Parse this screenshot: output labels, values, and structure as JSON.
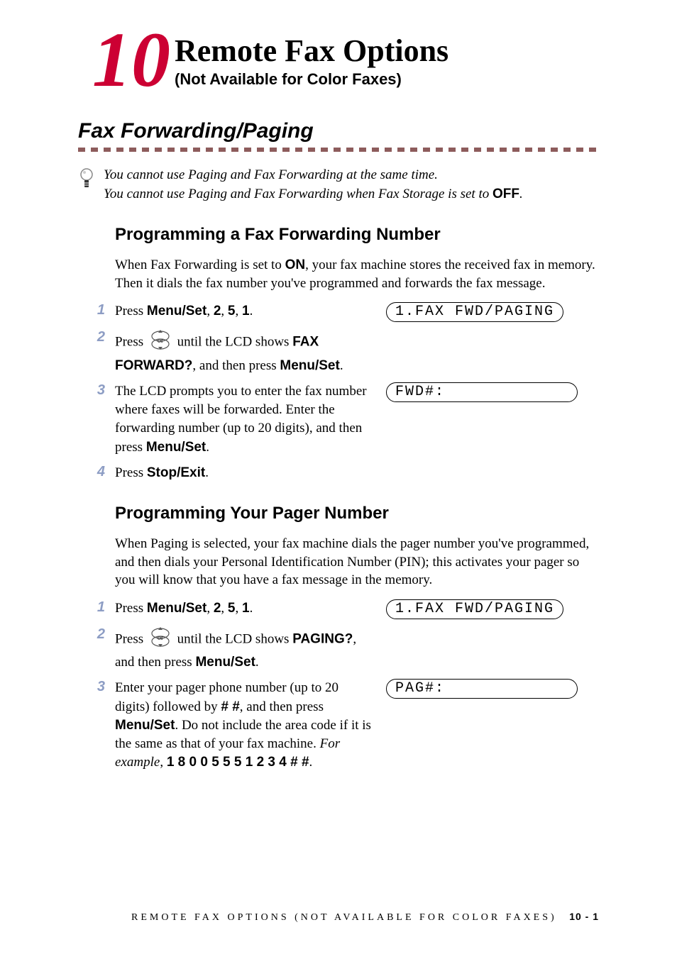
{
  "chapter": {
    "number": "10",
    "title": "Remote Fax Options",
    "subtitle": "(Not Available for Color Faxes)"
  },
  "section": {
    "title": "Fax Forwarding/Paging",
    "note_line1": "You cannot use Paging and Fax Forwarding at the same time.",
    "note_line2_a": "You cannot use Paging and Fax Forwarding when Fax Storage is set to ",
    "note_line2_b": "OFF",
    "note_line2_c": "."
  },
  "sub1": {
    "heading": "Programming a Fax Forwarding Number",
    "intro_a": "When Fax Forwarding is set to ",
    "intro_on": "ON",
    "intro_b": ", your fax machine stores the received fax in memory. Then it dials the fax number you've programmed and forwards the fax message.",
    "step1_a": "Press ",
    "step1_b": "Menu/Set",
    "step1_c": ", ",
    "step1_d": "2",
    "step1_e": ", ",
    "step1_f": "5",
    "step1_g": ", ",
    "step1_h": "1",
    "step1_i": ".",
    "lcd1": "1.FAX FWD/PAGING",
    "step2_a": "Press ",
    "step2_b": " until the LCD shows ",
    "step2_c": "FAX FORWARD?",
    "step2_d": ", and then press ",
    "step2_e": "Menu/Set",
    "step2_f": ".",
    "step3_a": "The LCD prompts you to enter the fax number where faxes will be forwarded. Enter the forwarding number (up to 20 digits), and then press ",
    "step3_b": "Menu/Set",
    "step3_c": ".",
    "lcd3": "FWD#:",
    "step4_a": "Press ",
    "step4_b": "Stop/Exit",
    "step4_c": "."
  },
  "sub2": {
    "heading": "Programming Your Pager Number",
    "intro": "When Paging is selected, your fax machine dials the pager number you've programmed, and then dials your Personal Identification Number (PIN); this activates your pager so you will know that you have a fax message in the memory.",
    "step1_a": "Press ",
    "step1_b": "Menu/Set",
    "step1_c": ", ",
    "step1_d": "2",
    "step1_e": ", ",
    "step1_f": "5",
    "step1_g": ", ",
    "step1_h": "1",
    "step1_i": ".",
    "lcd1": "1.FAX FWD/PAGING",
    "step2_a": "Press ",
    "step2_b": " until the LCD shows ",
    "step2_c": "PAGING?",
    "step2_d": ", and then press ",
    "step2_e": "Menu/Set",
    "step2_f": ".",
    "step3_a": "Enter your pager phone number (up to 20 digits) followed by ",
    "step3_b": "# #",
    "step3_c": ", and then press ",
    "step3_d": "Menu/Set",
    "step3_e": ". Do not include the area code if it is the same as that of your fax machine. ",
    "step3_eg_a": "For example",
    "step3_eg_b": ", ",
    "step3_eg_c": "1 8 0 0 5 5 5 1 2 3 4 # #",
    "step3_eg_d": ".",
    "lcd3": "PAG#:"
  },
  "footer": {
    "text": "REMOTE FAX OPTIONS (NOT AVAILABLE FOR COLOR FAXES)",
    "page": "10 - 1"
  },
  "nav_label": "or"
}
